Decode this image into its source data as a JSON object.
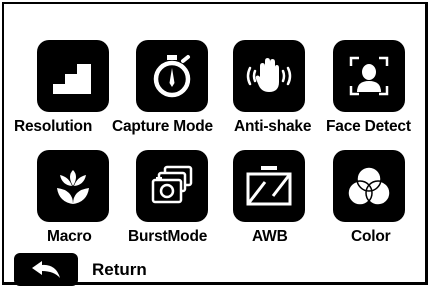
{
  "grid": {
    "row1": [
      {
        "label": "Resolution",
        "icon": "stairs-icon"
      },
      {
        "label": "Capture Mode",
        "icon": "stopwatch-icon"
      },
      {
        "label": "Anti-shake",
        "icon": "hand-shake-icon"
      },
      {
        "label": "Face Detect",
        "icon": "face-frame-icon"
      }
    ],
    "row2": [
      {
        "label": "Macro",
        "icon": "flower-icon"
      },
      {
        "label": "BurstMode",
        "icon": "burst-camera-icon"
      },
      {
        "label": "AWB",
        "icon": "white-balance-icon"
      },
      {
        "label": "Color",
        "icon": "color-circles-icon"
      }
    ]
  },
  "footer": {
    "return_label": "Return",
    "return_icon": "back-arrow-icon"
  },
  "colors": {
    "background": "#ffffff",
    "tile": "#000000",
    "icon": "#ffffff"
  }
}
